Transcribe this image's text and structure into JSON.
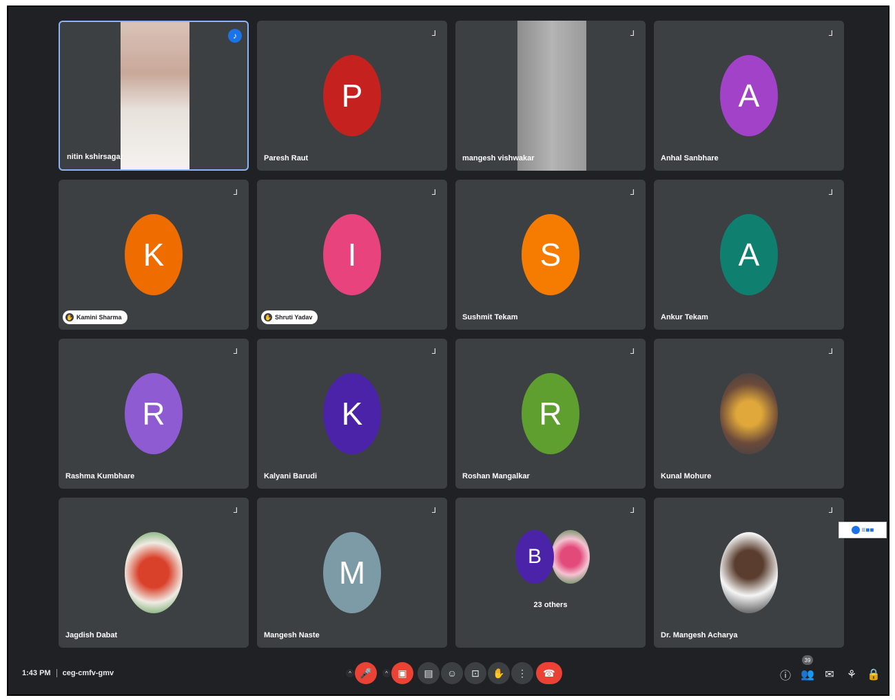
{
  "tiles": [
    {
      "name": "nitin kshirsagar",
      "type": "video",
      "speaking": true
    },
    {
      "name": "Paresh Raut",
      "avatar_letter": "P",
      "avatar_color": "#c5221f"
    },
    {
      "name": "mangesh vishwakar",
      "type": "video"
    },
    {
      "name": "Anhal Sanbhare",
      "avatar_letter": "A",
      "avatar_color": "#a142c8"
    },
    {
      "name": "Kamini Sharma",
      "avatar_letter": "K",
      "avatar_color": "#ef6c00",
      "pill": true
    },
    {
      "name": "Shruti Yadav",
      "avatar_letter": "I",
      "avatar_color": "#e8437d",
      "pill": true
    },
    {
      "name": "Sushmit Tekam",
      "avatar_letter": "S",
      "avatar_color": "#f57c00"
    },
    {
      "name": "Ankur Tekam",
      "avatar_letter": "A",
      "avatar_color": "#0f7f70"
    },
    {
      "name": "Rashma Kumbhare",
      "avatar_letter": "R",
      "avatar_color": "#8e5bd3"
    },
    {
      "name": "Kalyani Barudi",
      "avatar_letter": "K",
      "avatar_color": "#4a23a8"
    },
    {
      "name": "Roshan Mangalkar",
      "avatar_letter": "R",
      "avatar_color": "#5e9f2f"
    },
    {
      "name": "Kunal Mohure",
      "avatar_photo": "person-photo"
    },
    {
      "name": "Jagdish Dabat",
      "avatar_photo": "emblem-photo"
    },
    {
      "name": "Mangesh Naste",
      "avatar_letter": "M",
      "avatar_color": "#7d9ba6"
    },
    {
      "others_label": "23 others",
      "avatar_letter": "B",
      "avatar_color": "#4a23a8",
      "others": true
    },
    {
      "name": "Dr. Mangesh Acharya",
      "avatar_photo": "profile-photo"
    }
  ],
  "bottom": {
    "time": "1:43 PM",
    "meeting_code": "ceg-cmfv-gmv",
    "participants_count": "39"
  },
  "controls": {
    "mic": "mic-icon",
    "camera": "camera-off-icon",
    "captions": "captions-icon",
    "emoji": "emoji-icon",
    "present": "present-icon",
    "raise_hand": "hand-icon",
    "more": "more-icon",
    "end_call": "end-call-icon"
  },
  "overlay_logo_text": "≡■■"
}
